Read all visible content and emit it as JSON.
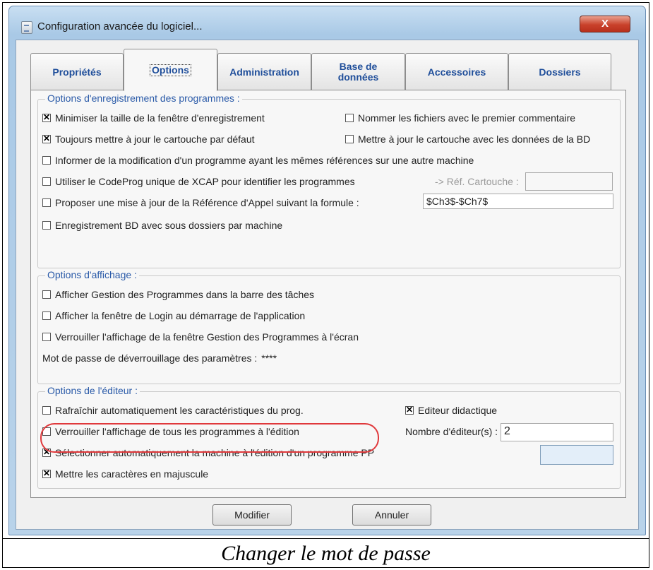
{
  "window": {
    "title": "Configuration avancée du logiciel...",
    "close_label": "X"
  },
  "tabs": [
    {
      "label": "Propriétés",
      "active": false
    },
    {
      "label": "Options",
      "active": true
    },
    {
      "label": "Administration",
      "active": false
    },
    {
      "label": "Base de données",
      "active": false
    },
    {
      "label": "Accessoires",
      "active": false
    },
    {
      "label": "Dossiers",
      "active": false
    }
  ],
  "recording": {
    "title": "Options d'enregistrement des programmes :",
    "minimize": {
      "label": "Minimiser la taille de la fenêtre d'enregistrement",
      "checked": true
    },
    "name_files": {
      "label": "Nommer les fichiers avec le premier commentaire",
      "checked": false
    },
    "update_cartouche": {
      "label": "Toujours mettre à jour le cartouche par défaut",
      "checked": true
    },
    "update_cartouche_bd": {
      "label": "Mettre à jour le cartouche avec les données de la BD",
      "checked": false
    },
    "inform_modification": {
      "label": "Informer de la modification d'un programme ayant les mêmes références sur une autre machine",
      "checked": false
    },
    "use_codeprog": {
      "label": "Utiliser le CodeProg unique de XCAP pour identifier les programmes",
      "checked": false
    },
    "ref_cartouche_label": "-> Réf. Cartouche :",
    "ref_cartouche_value": "",
    "propose_update": {
      "label": "Proposer une mise à jour de la Référence d'Appel suivant la formule :",
      "checked": false
    },
    "formula_value": "$Ch3$-$Ch7$",
    "subfolders": {
      "label": "Enregistrement BD avec sous dossiers par machine",
      "checked": false
    }
  },
  "display": {
    "title": "Options d'affichage :",
    "show_taskbar": {
      "label": "Afficher Gestion des Programmes dans la barre des tâches",
      "checked": false
    },
    "show_login": {
      "label": "Afficher la fenêtre de Login au démarrage de l'application",
      "checked": false
    },
    "lock_display": {
      "label": "Verrouiller l'affichage de la fenêtre Gestion des Programmes à l'écran",
      "checked": false
    },
    "password_label": "Mot de passe de déverrouillage des paramètres :",
    "password_value": "****"
  },
  "editor": {
    "title": "Options de l'éditeur :",
    "refresh_auto": {
      "label": "Rafraîchir automatiquement les caractéristiques du prog.",
      "checked": false
    },
    "didactic_editor": {
      "label": "Editeur didactique",
      "checked": true
    },
    "lock_all_programs": {
      "label": "Verrouiller l'affichage de tous les programmes à l'édition",
      "checked": false
    },
    "editor_count_label": "Nombre d'éditeur(s) :",
    "editor_count_value": "2",
    "select_machine": {
      "label": "Sélectionner automatiquement la machine à l'édition d'un programme PP",
      "checked": true
    },
    "uppercase": {
      "label": "Mettre les caractères en majuscule",
      "checked": true
    },
    "blue_field_value": ""
  },
  "buttons": {
    "modify": "Modifier",
    "cancel": "Annuler"
  },
  "caption": "Changer le mot de passe"
}
